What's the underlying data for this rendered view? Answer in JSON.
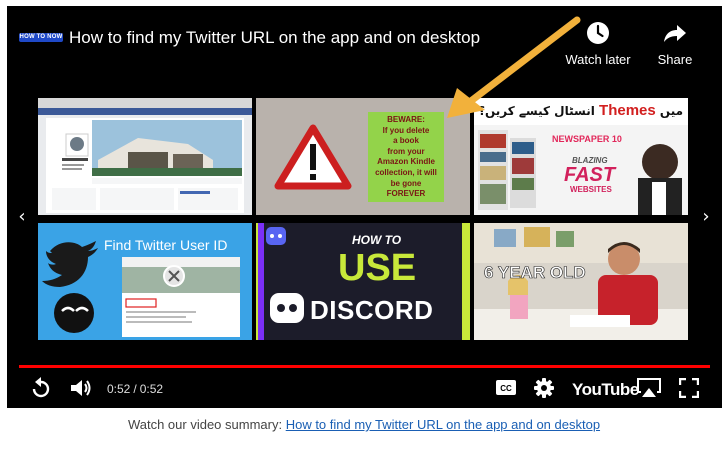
{
  "channel": {
    "logo_text": "HOW TO NOW"
  },
  "video": {
    "title": "How to find my Twitter URL on the app and on desktop"
  },
  "top_actions": [
    {
      "label": "Watch later",
      "icon": "clock-icon"
    },
    {
      "label": "Share",
      "icon": "share-arrow-icon"
    }
  ],
  "end_screen": {
    "videos": [
      {
        "thumbnail_text": ""
      },
      {
        "thumbnail_text": "BEWARE: If you delete a book from your Amazon Kindle collection, it will be gone FOREVER",
        "lines": [
          "BEWARE:",
          "If you delete",
          "a book",
          "from your",
          "Amazon Kindle",
          "collection, it will",
          "be gone",
          "FOREVER"
        ]
      },
      {
        "thumbnail_text": "ورڈپریس میں Themes انسٹال کیسے کریں؟",
        "urdu_left": "ورڈپریس میں",
        "themes_word": "Themes",
        "urdu_right": "انسٹال کیسے کریں؟",
        "newspaper": "NEWSPAPER 10",
        "blazing": "BLAZING",
        "fast": "FAST",
        "websites": "WEBSITES"
      },
      {
        "thumbnail_text": "Find Twitter User ID"
      },
      {
        "thumbnail_text": "HOW TO USE DISCORD",
        "line1": "HOW TO",
        "line2": "USE",
        "line3": "DISCORD"
      },
      {
        "thumbnail_text": "6 YEAR OLD"
      }
    ]
  },
  "playback": {
    "current_time": "0:52",
    "separator": "/",
    "duration": "0:52",
    "progress_fraction": 1.0
  },
  "controls": {
    "youtube_wordmark": "YouTube"
  },
  "summary": {
    "prefix": "Watch our video summary:",
    "link_text": "How to find my Twitter URL on the app and on desktop"
  },
  "colors": {
    "progress": "#ff0000",
    "link": "#1a5fb4",
    "arrow": "#f2b13b",
    "channel_logo": "#1f49c7"
  }
}
